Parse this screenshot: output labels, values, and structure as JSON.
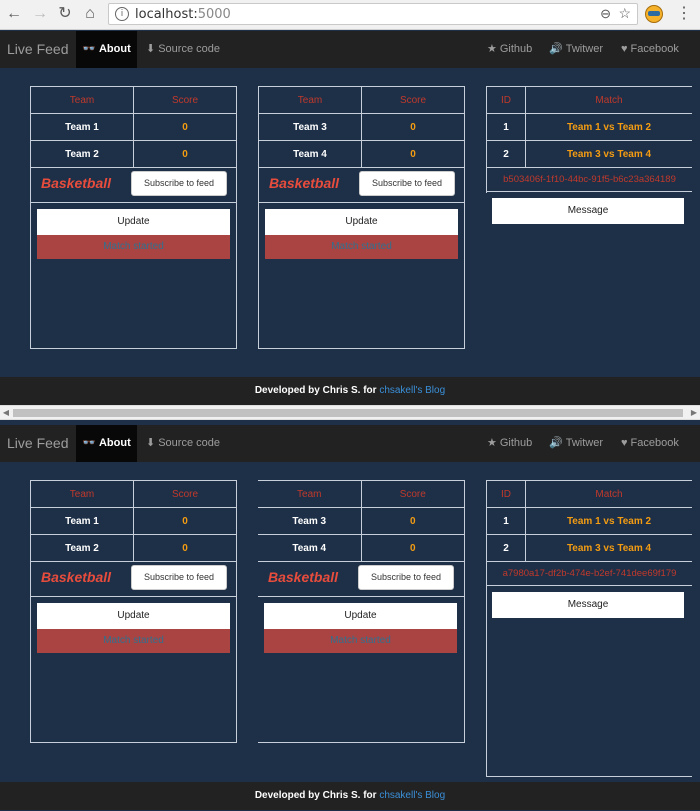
{
  "browser": {
    "url_host": "localhost:",
    "url_port": "5000",
    "zoom_icon": "zoom-out-icon",
    "bookmark_icon": "star-icon",
    "menu_icon": "kebab-menu-icon"
  },
  "navbar": {
    "brand": "Live Feed",
    "about": "About",
    "source": "Source code",
    "github": "Github",
    "twitter": "Twitwer",
    "facebook": "Facebook"
  },
  "panes": [
    {
      "games": [
        {
          "header_team": "Team",
          "header_score": "Score",
          "teams": [
            {
              "name": "Team 1",
              "score": "0"
            },
            {
              "name": "Team 2",
              "score": "0"
            }
          ],
          "sport": "Basketball",
          "subscribe": "Subscribe to feed",
          "update": "Update",
          "status": "Match started"
        },
        {
          "header_team": "Team",
          "header_score": "Score",
          "teams": [
            {
              "name": "Team 3",
              "score": "0"
            },
            {
              "name": "Team 4",
              "score": "0"
            }
          ],
          "sport": "Basketball",
          "subscribe": "Subscribe to feed",
          "update": "Update",
          "status": "Match started"
        }
      ],
      "matches": {
        "header_id": "ID",
        "header_match": "Match",
        "rows": [
          {
            "id": "1",
            "match": "Team 1 vs Team 2"
          },
          {
            "id": "2",
            "match": "Team 3 vs Team 4"
          }
        ],
        "connection_id": "b503406f-1f10-44bc-91f5-b6c23a364189",
        "message": "Message"
      }
    },
    {
      "games": [
        {
          "header_team": "Team",
          "header_score": "Score",
          "teams": [
            {
              "name": "Team 1",
              "score": "0"
            },
            {
              "name": "Team 2",
              "score": "0"
            }
          ],
          "sport": "Basketball",
          "subscribe": "Subscribe to feed",
          "update": "Update",
          "status": "Match started"
        },
        {
          "header_team": "Team",
          "header_score": "Score",
          "teams": [
            {
              "name": "Team 3",
              "score": "0"
            },
            {
              "name": "Team 4",
              "score": "0"
            }
          ],
          "sport": "Basketball",
          "subscribe": "Subscribe to feed",
          "update": "Update",
          "status": "Match started"
        }
      ],
      "matches": {
        "header_id": "ID",
        "header_match": "Match",
        "rows": [
          {
            "id": "1",
            "match": "Team 1 vs Team 2"
          },
          {
            "id": "2",
            "match": "Team 3 vs Team 4"
          }
        ],
        "connection_id": "a7980a17-df2b-474e-b2ef-741dee69f179",
        "message": "Message"
      }
    }
  ],
  "footer": {
    "text": "Developed by Chris S. for ",
    "link": "chsakell's Blog"
  },
  "colors": {
    "background": "#1e3048",
    "navbar": "#222222",
    "header_text": "#c0392b",
    "score_text": "#f39c12",
    "status_bg": "#a94442",
    "sport_text": "#e74c3c"
  }
}
